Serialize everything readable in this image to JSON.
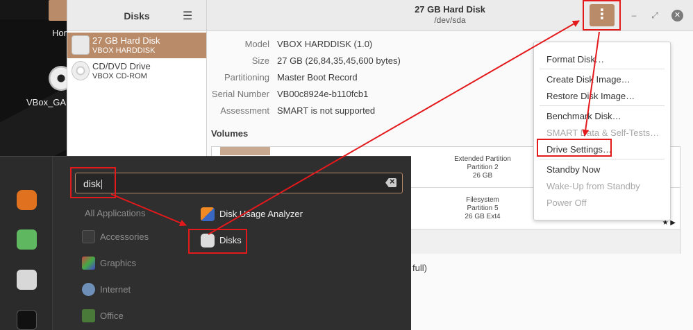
{
  "desktop": {
    "icons": [
      {
        "label": "Hor"
      },
      {
        "label": "VBox_GA"
      }
    ]
  },
  "disks": {
    "sidebar_title": "Disks",
    "window_title": "27 GB Hard Disk",
    "window_subtitle": "/dev/sda",
    "devices": [
      {
        "name": "27 GB Hard Disk",
        "sub": "VBOX HARDDISK",
        "selected": true
      },
      {
        "name": "CD/DVD Drive",
        "sub": "VBOX CD-ROM",
        "selected": false
      }
    ],
    "info": [
      {
        "key": "Model",
        "value": "VBOX HARDDISK (1.0)"
      },
      {
        "key": "Size",
        "value": "27 GB (26,84,35,45,600 bytes)"
      },
      {
        "key": "Partitioning",
        "value": "Master Boot Record"
      },
      {
        "key": "Serial Number",
        "value": "VB00c8924e-b110fcb1"
      },
      {
        "key": "Assessment",
        "value": "SMART is not supported"
      }
    ],
    "volumes_title": "Volumes",
    "volumes": [
      {
        "line1": "Extended Partition",
        "line2": "Partition 2",
        "line3": "26 GB"
      },
      {
        "line1": "Filesystem",
        "line2": "Partition 5",
        "line3": "26 GB Ext4"
      }
    ],
    "content_fragment": "full)",
    "menu_icon": "vertical-dots-icon",
    "accent_color": "#b98b69"
  },
  "popover": {
    "items": [
      {
        "label": "Format Disk…",
        "enabled": true
      },
      {
        "label": "Create Disk Image…",
        "enabled": true
      },
      {
        "label": "Restore Disk Image…",
        "enabled": true
      },
      {
        "label": "Benchmark Disk…",
        "enabled": true
      },
      {
        "label": "SMART Data & Self-Tests…",
        "enabled": false
      },
      {
        "label": "Drive Settings…",
        "enabled": true
      },
      {
        "label": "Standby Now",
        "enabled": true
      },
      {
        "label": "Wake-Up from Standby",
        "enabled": false
      },
      {
        "label": "Power Off",
        "enabled": false
      }
    ]
  },
  "launcher": {
    "search_value": "disk",
    "categories": [
      {
        "label": "All Applications"
      },
      {
        "label": "Accessories"
      },
      {
        "label": "Graphics"
      },
      {
        "label": "Internet"
      },
      {
        "label": "Office"
      }
    ],
    "results": [
      {
        "label": "Disk Usage Analyzer",
        "icon": "disk-usage-analyzer-icon"
      },
      {
        "label": "Disks",
        "icon": "disks-app-icon"
      }
    ],
    "favorites": [
      "firefox-icon",
      "calculator-icon",
      "settings-toggle-icon",
      "terminal-icon"
    ]
  },
  "annotation_color": "#e3191b"
}
